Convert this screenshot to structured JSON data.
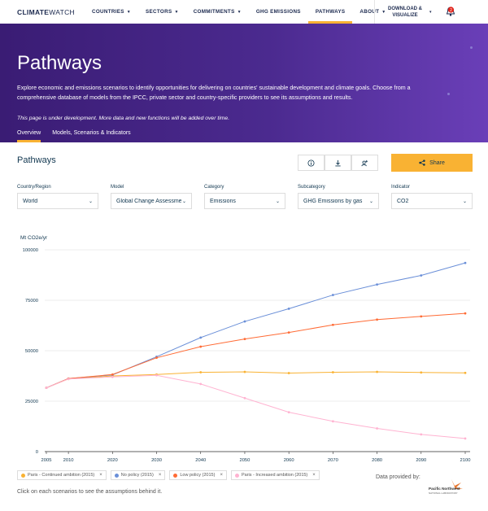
{
  "nav": {
    "logo_bold": "CLIMATE",
    "logo_rest": "WATCH",
    "items": [
      {
        "label": "COUNTRIES",
        "caret": true,
        "active": false
      },
      {
        "label": "SECTORS",
        "caret": true,
        "active": false
      },
      {
        "label": "COMMITMENTS",
        "caret": true,
        "active": false
      },
      {
        "label": "GHG EMISSIONS",
        "caret": false,
        "active": false
      },
      {
        "label": "PATHWAYS",
        "caret": false,
        "active": true
      },
      {
        "label": "ABOUT",
        "caret": true,
        "active": false
      }
    ],
    "download_line1": "DOWNLOAD &",
    "download_line2": "VISUALIZE",
    "notification_count": "2"
  },
  "hero": {
    "title": "Pathways",
    "description": "Explore economic and emissions scenarios to identify opportunities for delivering on countries' sustainable development and climate goals. Choose from a comprehensive database of models from the IPCC, private sector and country-specific providers to see its assumptions and results.",
    "dev_note": "This page is under development. More data and new functions will be added over time.",
    "tabs": [
      {
        "label": "Overview",
        "active": true
      },
      {
        "label": "Models, Scenarios & Indicators",
        "active": false
      }
    ]
  },
  "panel": {
    "title": "Pathways",
    "tools": [
      "info-icon",
      "download-icon",
      "add-user-icon"
    ],
    "share_label": "Share",
    "filters": [
      {
        "label": "Country/Region",
        "value": "World"
      },
      {
        "label": "Model",
        "value": "Global Change Assessment..."
      },
      {
        "label": "Category",
        "value": "Emissions"
      },
      {
        "label": "Subcategory",
        "value": "GHG Emissions by gas"
      },
      {
        "label": "Indicator",
        "value": "CO2"
      }
    ]
  },
  "chart_data": {
    "type": "line",
    "ylabel": "Mt CO2e/yr",
    "ylim": [
      0,
      100000
    ],
    "yticks": [
      "0",
      "25000",
      "50000",
      "75000",
      "100000"
    ],
    "x": [
      2005,
      2010,
      2020,
      2030,
      2040,
      2050,
      2060,
      2070,
      2080,
      2090,
      2100
    ],
    "series": [
      {
        "name": "Paris - Continued ambition (2015)",
        "color": "#f9b233",
        "values": [
          31600,
          36000,
          37500,
          38200,
          39300,
          39500,
          38900,
          39300,
          39500,
          39200,
          39000
        ]
      },
      {
        "name": "No policy (2015)",
        "color": "#6a8fd8",
        "values": [
          31600,
          36200,
          38000,
          47000,
          56500,
          64500,
          70800,
          77600,
          82800,
          87300,
          93500
        ]
      },
      {
        "name": "Low policy (2015)",
        "color": "#ff6b35",
        "values": [
          31600,
          36200,
          38200,
          46500,
          52000,
          55800,
          59000,
          62800,
          65400,
          67000,
          68500
        ]
      },
      {
        "name": "Paris - Increased ambition (2015)",
        "color": "#ffb3d1",
        "values": [
          31600,
          36000,
          37000,
          37800,
          33500,
          26500,
          19500,
          15000,
          11500,
          8500,
          6500
        ]
      }
    ]
  },
  "footer": {
    "provided_by": "Data provided by:",
    "provider_line1": "Pacific Northwest",
    "provider_line2": "NATIONAL LABORATORY",
    "hint": "Click on each scenarios to see the assumptions behind it."
  }
}
